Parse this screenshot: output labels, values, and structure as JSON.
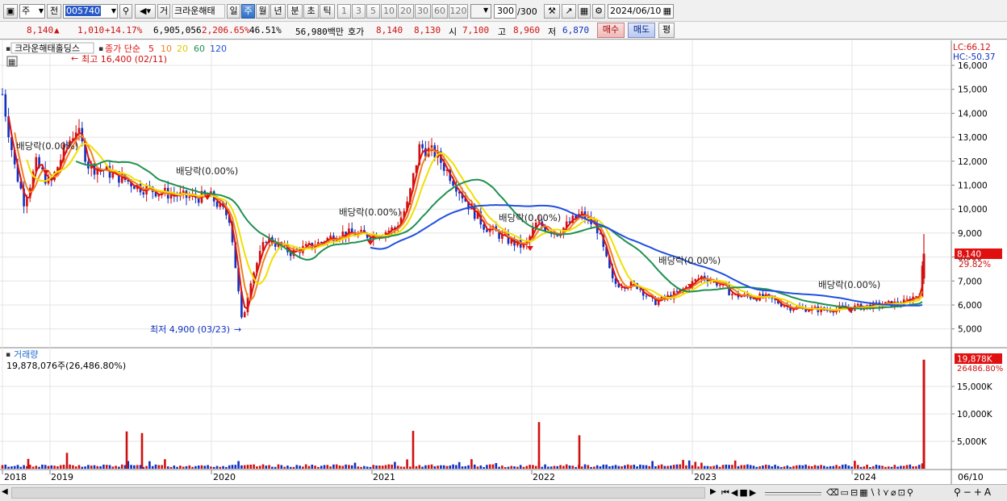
{
  "toolbar": {
    "type_select": "주",
    "prev_label": "전",
    "code": "005740",
    "item_button": "거",
    "stock_name": "크라운해태",
    "periods": [
      "일",
      "주",
      "월",
      "년",
      "분",
      "초",
      "틱"
    ],
    "selected_period": "주",
    "intervals": [
      "1",
      "3",
      "5",
      "10",
      "20",
      "30",
      "60",
      "120"
    ],
    "count": "300",
    "count_total": "/300",
    "date": "2024/06/10"
  },
  "quote": {
    "price": "8,140",
    "change": "1,010",
    "change_pct": "+14.17%",
    "volume": "6,905,056",
    "volume_ratio": "2,206.65%",
    "turnover": "46.51%",
    "amount": "56,980백만",
    "hoga_label": "호가",
    "ask": "8,140",
    "bid": "8,130",
    "open_label": "시",
    "open": "7,100",
    "high_label": "고",
    "high": "8,960",
    "low_label": "저",
    "low": "6,870",
    "buy_button": "매수",
    "sell_button": "매도",
    "eval_button": "평"
  },
  "price_pane": {
    "name_tag": "크라운해태홀딩스",
    "ma_title": "종가 단순",
    "ma_periods": [
      "5",
      "10",
      "20",
      "60",
      "120"
    ],
    "ma_colors": [
      "#e01010",
      "#f08020",
      "#f0e000",
      "#209050",
      "#2050e0"
    ],
    "lc_label": "LC:66.12",
    "hc_label": "HC:-50.37",
    "high_annotation": "최고 16,400 (02/11)",
    "low_annotation": "최저 4,900 (03/23)",
    "dividend_labels": [
      "배당락(0.00%)",
      "배당락(0.00%)",
      "배당락(0.00%)",
      "배당락(0.00%)",
      "배당락(0.00%)",
      "배당락(0.00%)"
    ],
    "price_ticks": [
      "16,000",
      "15,000",
      "14,000",
      "13,000",
      "12,000",
      "11,000",
      "10,000",
      "9,000",
      "8,000",
      "7,000",
      "6,000",
      "5,000"
    ],
    "current_price_tag": "8,140",
    "current_pct_tag": "29.82%"
  },
  "volume_pane": {
    "title": "거래량",
    "info": "19,878,076주(26,486.80%)",
    "ticks": [
      "15,000K",
      "10,000K",
      "5,000K"
    ],
    "current_tag": "19,878K",
    "current_pct_tag": "26486.80%"
  },
  "x_axis": {
    "labels": [
      "2018",
      "2019",
      "2020",
      "2021",
      "2022",
      "2023",
      "2024",
      "06/10"
    ]
  },
  "chart_data": {
    "type": "line",
    "x": [
      "2018",
      "2019",
      "2020",
      "2021",
      "2022",
      "2023",
      "2024"
    ],
    "series": [],
    "ylim": [
      4500,
      16500
    ],
    "ytick_labels": [
      "16,000",
      "15,000",
      "14,000",
      "13,000",
      "12,000",
      "11,000",
      "10,000",
      "9,000",
      "8,000",
      "7,000",
      "6,000",
      "5,000"
    ],
    "volume_ylim": [
      0,
      20000000
    ],
    "last_close": 8140,
    "last_volume": 19878076,
    "grid": true
  }
}
